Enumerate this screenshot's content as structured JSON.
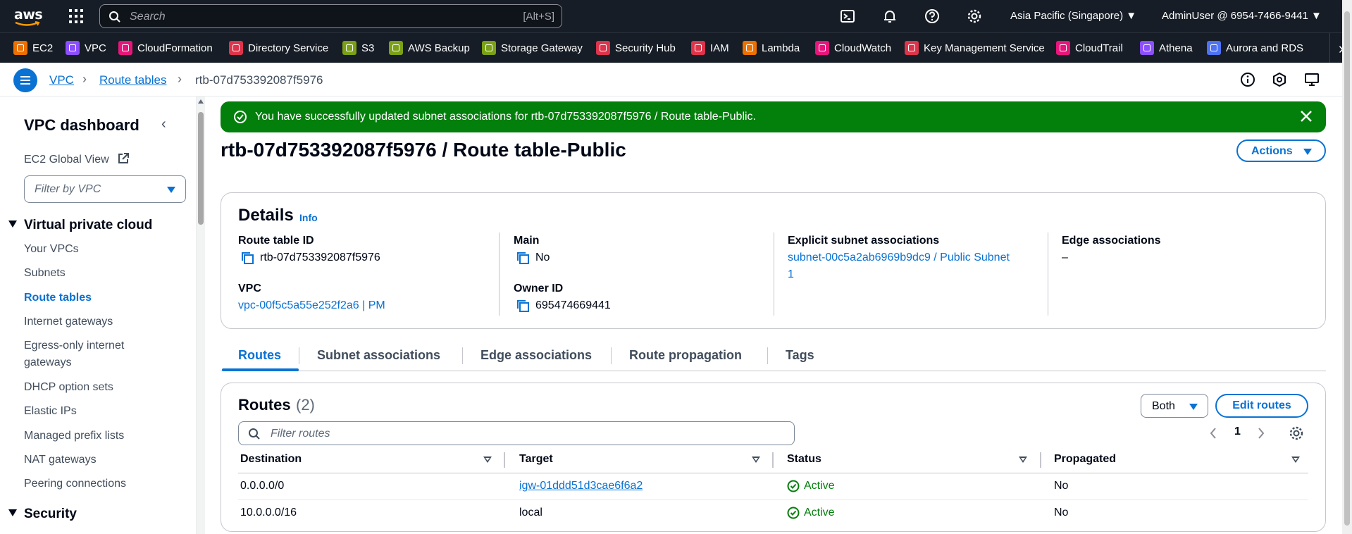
{
  "topnav": {
    "search_placeholder": "Search",
    "search_shortcut": "[Alt+S]",
    "region": "Asia Pacific (Singapore) ▼",
    "account": "AdminUser @ 6954-7466-9441 ▼"
  },
  "services": [
    {
      "label": "EC2",
      "color": "#ed7100"
    },
    {
      "label": "VPC",
      "color": "#8c4fff"
    },
    {
      "label": "CloudFormation",
      "color": "#e7157b"
    },
    {
      "label": "Directory Service",
      "color": "#dd344c"
    },
    {
      "label": "S3",
      "color": "#7aa116"
    },
    {
      "label": "AWS Backup",
      "color": "#7aa116"
    },
    {
      "label": "Storage Gateway",
      "color": "#7aa116"
    },
    {
      "label": "Security Hub",
      "color": "#dd344c"
    },
    {
      "label": "IAM",
      "color": "#dd344c"
    },
    {
      "label": "Lambda",
      "color": "#ed7100"
    },
    {
      "label": "CloudWatch",
      "color": "#e7157b"
    },
    {
      "label": "Key Management Service",
      "color": "#dd344c"
    },
    {
      "label": "CloudTrail",
      "color": "#e7157b"
    },
    {
      "label": "Athena",
      "color": "#8c4fff"
    },
    {
      "label": "Aurora and RDS",
      "color": "#4d72f3"
    }
  ],
  "breadcrumb": {
    "vpc": "VPC",
    "route_tables": "Route tables",
    "current": "rtb-07d753392087f5976"
  },
  "sidebar": {
    "title": "VPC dashboard",
    "ec2_global_view": "EC2 Global View",
    "filter_placeholder": "Filter by VPC",
    "section_vpc": "Virtual private cloud",
    "items": [
      "Your VPCs",
      "Subnets",
      "Route tables",
      "Internet gateways",
      "Egress-only internet gateways",
      "DHCP option sets",
      "Elastic IPs",
      "Managed prefix lists",
      "NAT gateways",
      "Peering connections"
    ],
    "section_security": "Security"
  },
  "flash": {
    "message": "You have successfully updated subnet associations for rtb-07d753392087f5976 / Route table-Public."
  },
  "page": {
    "title": "rtb-07d753392087f5976 / Route table-Public",
    "actions_label": "Actions"
  },
  "details": {
    "title": "Details",
    "info": "Info",
    "route_table_id_label": "Route table ID",
    "route_table_id": "rtb-07d753392087f5976",
    "main_label": "Main",
    "main": "No",
    "explicit_label": "Explicit subnet associations",
    "explicit_line1": "subnet-00c5a2ab6969b9dc9 / Public Subnet",
    "explicit_line2": "1",
    "edge_label": "Edge associations",
    "edge": "–",
    "vpc_label": "VPC",
    "vpc": "vpc-00f5c5a55e252f2a6 | PM",
    "owner_label": "Owner ID",
    "owner": "695474669441"
  },
  "tabs": [
    "Routes",
    "Subnet associations",
    "Edge associations",
    "Route propagation",
    "Tags"
  ],
  "routes": {
    "title": "Routes",
    "count": "(2)",
    "both_label": "Both",
    "edit_label": "Edit routes",
    "filter_placeholder": "Filter routes",
    "page": "1",
    "columns": [
      "Destination",
      "Target",
      "Status",
      "Propagated"
    ],
    "rows": [
      {
        "destination": "0.0.0.0/0",
        "target": "igw-01ddd51d3cae6f6a2",
        "status": "Active",
        "propagated": "No"
      },
      {
        "destination": "10.0.0.0/16",
        "target": "local",
        "status": "Active",
        "propagated": "No"
      }
    ]
  }
}
